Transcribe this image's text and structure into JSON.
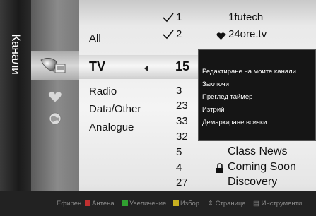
{
  "title": "Канали",
  "categories": {
    "all": "All",
    "tv": "TV",
    "radio": "Radio",
    "data_other": "Data/Other",
    "analogue": "Analogue"
  },
  "channel_numbers": [
    "1",
    "2",
    "15",
    "3",
    "23",
    "33",
    "32",
    "5",
    "4",
    "27"
  ],
  "channel_names": {
    "ch1": "1futech",
    "ch2": "24ore.tv",
    "class_news": "Class News",
    "coming_soon": "Coming Soon",
    "discovery": "Discovery"
  },
  "context_menu": {
    "items": [
      "Редактиране на моите канали",
      "Заключи",
      "Преглед таймер",
      "Изтрий",
      "Демаркиране всички"
    ]
  },
  "bottom_bar": {
    "efiren": "Ефирен",
    "antenna": "Антена",
    "zoom": "Увеличение",
    "select": "Избор",
    "page": "Страница",
    "tools": "Инструменти"
  },
  "colors": {
    "key_a": "#c03030",
    "key_b": "#30a030",
    "key_c": "#c8b020",
    "key_d": "#3060c0"
  },
  "icons": [
    "tv-icon",
    "heart-icon",
    "globe-icon",
    "checkmark-icon",
    "lock-icon",
    "up-down-arrows-icon",
    "tools-icon"
  ]
}
